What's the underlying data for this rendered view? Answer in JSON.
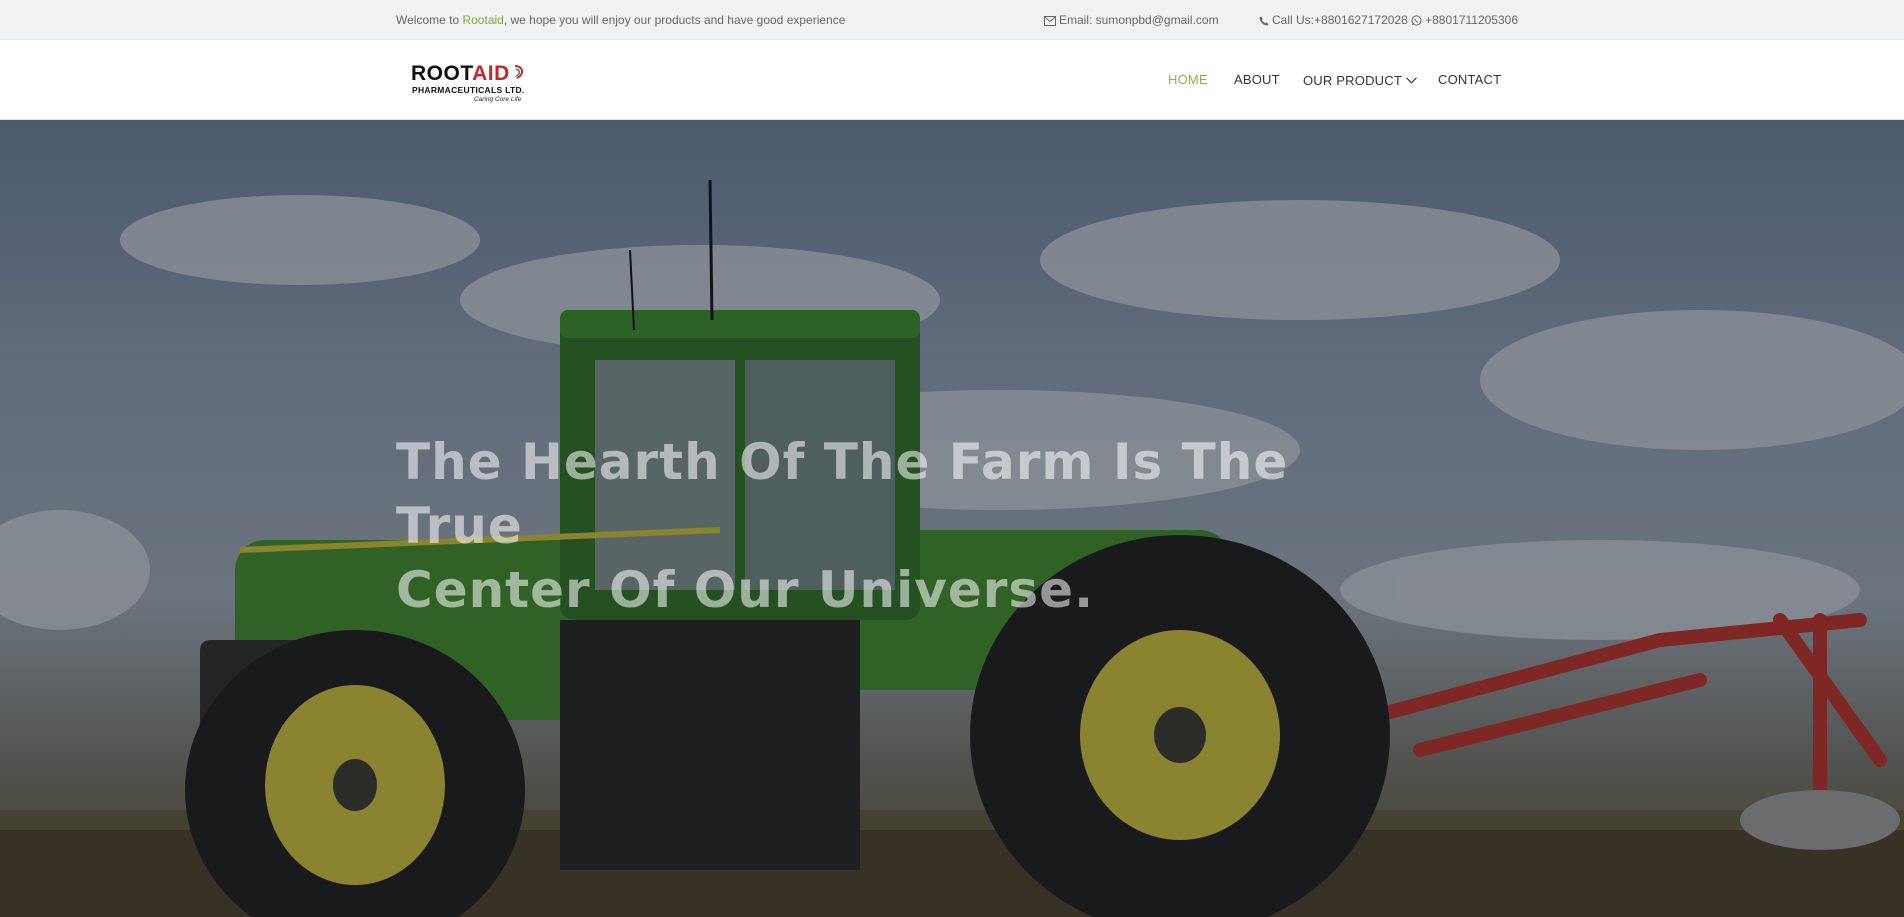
{
  "topbar": {
    "welcome_prefix": "Welcome to ",
    "brand_name": "Rootaid",
    "welcome_suffix": ", we hope you will enjoy our products and have good experience",
    "email_text": "Email: sumonpbd@gmail.com",
    "phone_text": "Call Us:+8801627172028",
    "whatsapp_text": "+8801711205306"
  },
  "logo": {
    "line1_root": "ROOT",
    "line1_ai": "AID",
    "line2": "PHARMACEUTICALS LTD.",
    "tagline": "Caring Core Life"
  },
  "nav": {
    "home": "HOME",
    "about": "ABOUT",
    "product": "OUR PRODUCT",
    "contact": "CONTACT"
  },
  "hero": {
    "title_line1": "The Hearth Of The Farm Is The True",
    "title_line2": "Center Of Our Universe."
  },
  "colors": {
    "accent": "#8cb33f",
    "brand_link": "#7fa83a",
    "logo_red": "#c7252b",
    "tractor_green": "#3f8a2c",
    "wheel_yellow": "#c9bd3a",
    "implement_red": "#b8302a"
  }
}
